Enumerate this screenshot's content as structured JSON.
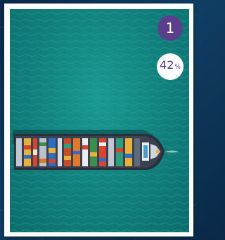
{
  "card": {
    "image_subject": "container-ship-aerial",
    "rank": "1",
    "percent_value": "42",
    "percent_unit": "%"
  },
  "colors": {
    "sea": "#127f7c",
    "rank_badge_bg": "#5b3f8c",
    "percent_text": "#4a3a7a",
    "backdrop": "#0b2a4a"
  }
}
